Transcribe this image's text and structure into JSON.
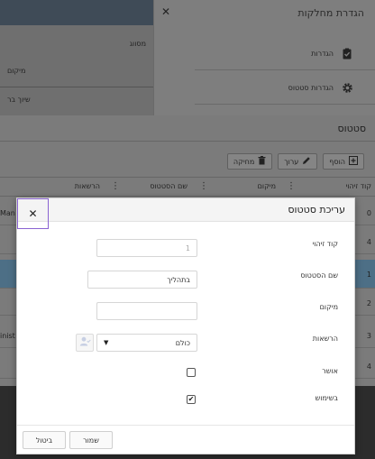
{
  "background": {
    "left_texts": [
      "מיקום",
      "שיוך בר"
    ],
    "column_text": "מסווג"
  },
  "dept_panel": {
    "title": "הגדרת מחלקות",
    "items": [
      {
        "label": "הגדרות",
        "icon": "clipboard-check-icon"
      },
      {
        "label": "הגדרות סטטוס",
        "icon": "gear-icon"
      }
    ]
  },
  "status_panel": {
    "title": "סטטוס",
    "toolbar": {
      "add_label": "הוסף",
      "edit_label": "ערוך",
      "delete_label": "מחיקה"
    },
    "columns": {
      "id": "קוד זיהוי",
      "location": "מיקום",
      "name": "שם הסטטוס",
      "permissions": "הרשאות"
    },
    "rows": [
      {
        "id": "0",
        "left": "Man"
      },
      {
        "id": "4",
        "left": ""
      },
      {
        "id": "1",
        "left": ""
      },
      {
        "id": "2",
        "left": ""
      },
      {
        "id": "3",
        "left": "inist"
      },
      {
        "id": "4",
        "left": ""
      }
    ]
  },
  "dialog": {
    "title": "עריכת סטטוס",
    "fields": {
      "id_label": "קוד זיהוי",
      "id_value": "1",
      "name_label": "שם הסטטוס",
      "name_value": "בתהליך",
      "location_label": "מיקום",
      "location_value": "",
      "permissions_label": "הרשאות",
      "permissions_value": "כולם",
      "approval_label": "אושר",
      "approval_checked": false,
      "in_use_label": "בשימוש",
      "in_use_checked": true
    },
    "buttons": {
      "save": "שמור",
      "cancel": "ביטול"
    }
  }
}
